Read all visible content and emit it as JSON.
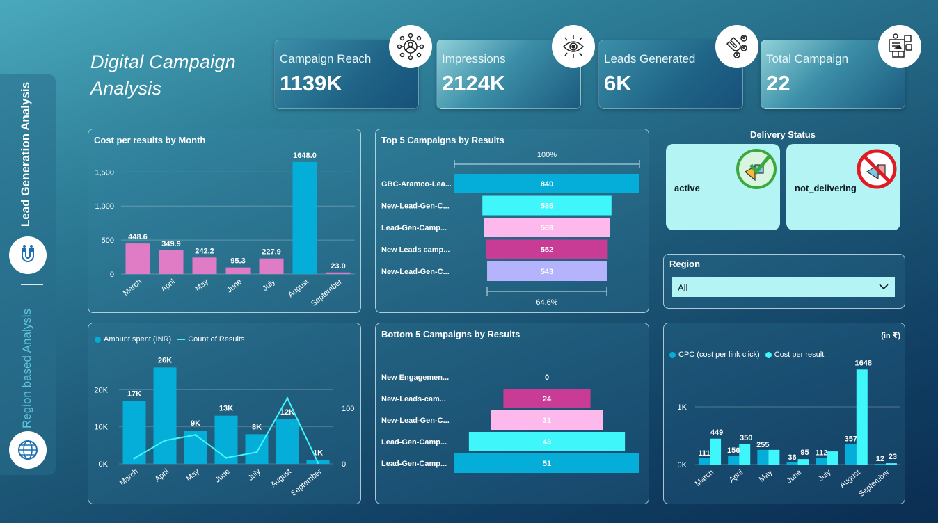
{
  "nav": {
    "lead_generation_label": "Lead Generation Analysis",
    "region_label": "Region based Analysis"
  },
  "title": {
    "line1": "Digital Campaign",
    "line2": "Analysis"
  },
  "kpis": [
    {
      "label": "Campaign Reach",
      "value": "1139K",
      "icon": "network-people-icon"
    },
    {
      "label": "Impressions",
      "value": "2124K",
      "icon": "eye-network-icon"
    },
    {
      "label": "Leads Generated",
      "value": "6K",
      "icon": "magnet-people-icon"
    },
    {
      "label": "Total Campaign",
      "value": "22",
      "icon": "marketing-screen-icon"
    }
  ],
  "cost_chart": {
    "title": "Cost per results by Month",
    "colors": {
      "pink": "#e07cc5",
      "blue": "#05aed8"
    }
  },
  "top5": {
    "title": "Top 5 Campaigns by Results",
    "top_label": "100%",
    "bottom_label": "64.6%"
  },
  "bottom5": {
    "title": "Bottom 5 Campaigns by Results"
  },
  "amount_chart": {
    "legend_bar": "Amount spent (INR)",
    "legend_line": "Count of Results"
  },
  "cpc_chart": {
    "unit": "(in ₹)",
    "legend_cpc": "CPC (cost per link click)",
    "legend_cpr": "Cost per result"
  },
  "delivery": {
    "title": "Delivery Status",
    "active": "active",
    "not_delivering": "not_delivering"
  },
  "region": {
    "title": "Region",
    "selected": "All"
  },
  "chart_data": [
    {
      "type": "bar",
      "title": "Cost per results by Month",
      "categories": [
        "March",
        "April",
        "May",
        "June",
        "July",
        "August",
        "September"
      ],
      "values": [
        448.6,
        349.9,
        242.2,
        95.3,
        227.9,
        1648.0,
        23.0
      ],
      "value_labels": [
        "448.6",
        "349.9",
        "242.2",
        "95.3",
        "227.9",
        "1648.0",
        "23.0"
      ],
      "highlight_index": 5,
      "yticks": [
        "0",
        "500",
        "1,000",
        "1,500"
      ],
      "ylim": [
        0,
        1800
      ]
    },
    {
      "type": "bar",
      "title": "Top 5 Campaigns by Results",
      "orientation": "funnel",
      "categories": [
        "GBC-Aramco-Lea...",
        "New-Lead-Gen-C...",
        "Lead-Gen-Camp...",
        "New Leads camp...",
        "New-Lead-Gen-C..."
      ],
      "values": [
        840,
        586,
        569,
        552,
        543
      ],
      "colors": [
        "#05aed8",
        "#3ff6fa",
        "#fdb9eb",
        "#c93c96",
        "#b5b3fb"
      ]
    },
    {
      "type": "bar",
      "title": "Bottom 5 Campaigns by Results",
      "orientation": "funnel",
      "categories": [
        "New Engagemen...",
        "New-Leads-cam...",
        "New-Lead-Gen-C...",
        "Lead-Gen-Camp...",
        "Lead-Gen-Camp..."
      ],
      "values": [
        0,
        24,
        31,
        43,
        51
      ],
      "colors": [
        "#05aed8",
        "#c93c96",
        "#fdb9eb",
        "#3ff6fa",
        "#05aed8"
      ]
    },
    {
      "type": "bar",
      "title": "",
      "categories": [
        "March",
        "April",
        "May",
        "June",
        "July",
        "August",
        "September"
      ],
      "series": [
        {
          "name": "Amount spent (INR)",
          "values": [
            17000,
            26000,
            9000,
            13000,
            8000,
            12000,
            1000
          ],
          "labels": [
            "17K",
            "26K",
            "9K",
            "13K",
            "8K",
            "12K",
            "1K"
          ]
        },
        {
          "name": "Count of Results",
          "values": [
            10,
            42,
            52,
            11,
            21,
            118,
            2
          ]
        }
      ],
      "y_left": {
        "ticks": [
          "0K",
          "10K",
          "20K"
        ],
        "ylim": [
          0,
          30000
        ]
      },
      "y_right": {
        "ticks": [
          "0",
          "100"
        ],
        "ylim": [
          0,
          200
        ]
      }
    },
    {
      "type": "bar",
      "title": "",
      "categories": [
        "March",
        "April",
        "May",
        "June",
        "July",
        "August",
        "September"
      ],
      "series": [
        {
          "name": "CPC (cost per link click)",
          "values": [
            111,
            156,
            255,
            36,
            112,
            357,
            12
          ],
          "color": "#05aed8"
        },
        {
          "name": "Cost per result",
          "values": [
            449,
            350,
            255,
            95,
            228,
            1648,
            23
          ],
          "color": "#3ff6fa"
        }
      ],
      "value_labels_cpc": [
        "111",
        "156",
        "255",
        "36",
        "112",
        "357",
        "12"
      ],
      "value_labels_cpr": [
        "449",
        "350",
        "",
        "95",
        "",
        "1648",
        "23"
      ],
      "yticks": [
        "0K",
        "1K"
      ],
      "ylim": [
        0,
        1700
      ]
    }
  ]
}
